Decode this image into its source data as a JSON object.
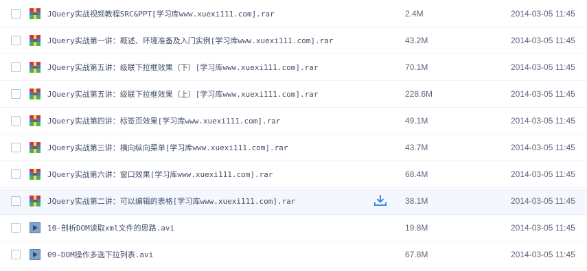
{
  "icons": {
    "rar": "archive-rar-icon",
    "avi": "video-avi-icon",
    "download": "download-icon"
  },
  "colors": {
    "row_hover_bg": "#f4f8fe",
    "download_icon": "#3b8cde",
    "text": "#424e67"
  },
  "files": [
    {
      "name": "JQuery实战视频教程SRC&PPT[学习库www.xuexi111.com].rar",
      "size": "2.4M",
      "date": "2014-03-05 11:45",
      "type": "rar"
    },
    {
      "name": "JQuery实战第一讲：概述、环境准备及入门实例[学习库www.xuexi111.com].rar",
      "size": "43.2M",
      "date": "2014-03-05 11:45",
      "type": "rar"
    },
    {
      "name": "JQuery实战第五讲：级联下拉框效果（下）[学习库www.xuexi111.com].rar",
      "size": "70.1M",
      "date": "2014-03-05 11:45",
      "type": "rar"
    },
    {
      "name": "JQuery实战第五讲：级联下拉框效果（上）[学习库www.xuexi111.com].rar",
      "size": "228.6M",
      "date": "2014-03-05 11:45",
      "type": "rar"
    },
    {
      "name": "JQuery实战第四讲：标签页效果[学习库www.xuexi111.com].rar",
      "size": "49.1M",
      "date": "2014-03-05 11:45",
      "type": "rar"
    },
    {
      "name": "JQuery实战第三讲：横向纵向菜单[学习库www.xuexi111.com].rar",
      "size": "43.7M",
      "date": "2014-03-05 11:45",
      "type": "rar"
    },
    {
      "name": "JQuery实战第六讲：窗口效果[学习库www.xuexi111.com].rar",
      "size": "68.4M",
      "date": "2014-03-05 11:45",
      "type": "rar"
    },
    {
      "name": "JQuery实战第二讲：可以编辑的表格[学习库www.xuexi111.com].rar",
      "size": "38.1M",
      "date": "2014-03-05 11:45",
      "type": "rar"
    },
    {
      "name": "10-剖析DOM读取xml文件的思路.avi",
      "size": "19.8M",
      "date": "2014-03-05 11:45",
      "type": "avi"
    },
    {
      "name": "09-DOM操作多选下拉列表.avi",
      "size": "67.8M",
      "date": "2014-03-05 11:45",
      "type": "avi"
    }
  ]
}
